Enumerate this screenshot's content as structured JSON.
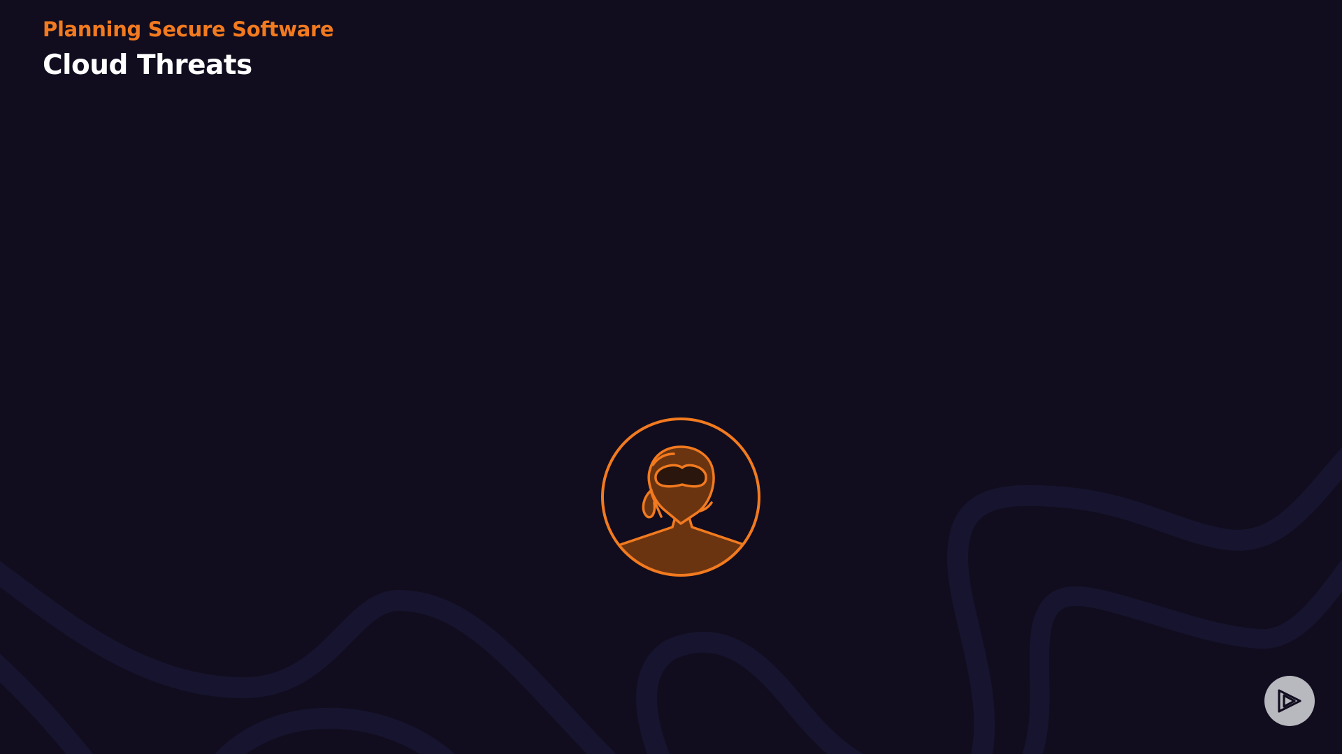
{
  "header": {
    "subtitle": "Planning Secure Software",
    "title": "Cloud Threats"
  },
  "icons": {
    "main": "masked-attacker-icon",
    "corner": "play-logo-icon"
  },
  "colors": {
    "background": "#110d1f",
    "accent": "#f27a1f",
    "title": "#ffffff",
    "wave": "#17142f",
    "icon_fill": "#6b3410",
    "play_button": "#b8b8bf"
  }
}
